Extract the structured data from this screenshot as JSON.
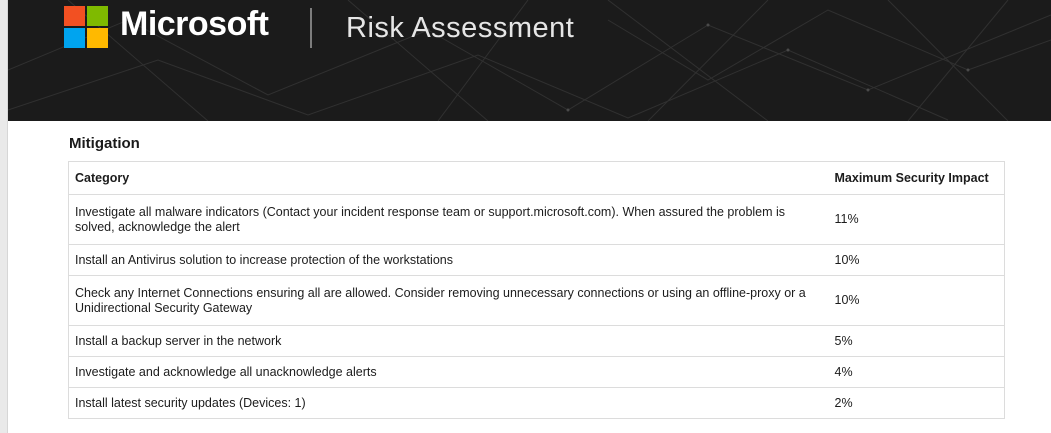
{
  "header": {
    "brand": "Microsoft",
    "product": "Risk Assessment",
    "colors": {
      "background": "#1b1b1b",
      "logo_red": "#f25022",
      "logo_green": "#7fba00",
      "logo_blue": "#00a4ef",
      "logo_yellow": "#ffb900"
    }
  },
  "section": {
    "title": "Mitigation"
  },
  "table": {
    "headers": {
      "category": "Category",
      "impact": "Maximum Security Impact"
    },
    "rows": [
      {
        "category": "Investigate all malware indicators (Contact your incident response team or support.microsoft.com). When assured the problem is solved, acknowledge the alert",
        "impact": "11%"
      },
      {
        "category": "Install an Antivirus solution to increase protection of the workstations",
        "impact": "10%"
      },
      {
        "category": "Check any Internet Connections ensuring all are allowed. Consider removing unnecessary connections or using an offline-proxy or a Unidirectional Security Gateway",
        "impact": "10%"
      },
      {
        "category": "Install a backup server in the network",
        "impact": "5%"
      },
      {
        "category": "Investigate and acknowledge all unacknowledge alerts",
        "impact": "4%"
      },
      {
        "category": "Install latest security updates (Devices: 1)",
        "impact": "2%"
      }
    ]
  }
}
